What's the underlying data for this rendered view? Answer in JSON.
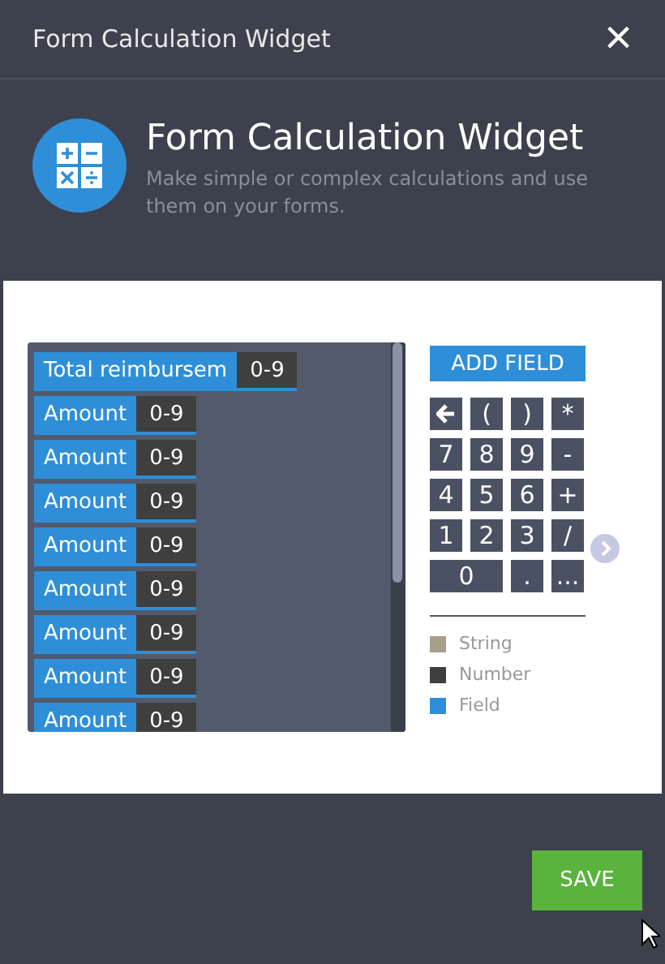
{
  "window": {
    "title": "Form Calculation Widget",
    "close": "×"
  },
  "intro": {
    "title": "Form Calculation Widget",
    "description": "Make simple or complex calculations and use them on your forms."
  },
  "fields": [
    {
      "name": "Total reimbursem",
      "type": "0-9"
    },
    {
      "name": "Amount",
      "type": "0-9"
    },
    {
      "name": "Amount",
      "type": "0-9"
    },
    {
      "name": "Amount",
      "type": "0-9"
    },
    {
      "name": "Amount",
      "type": "0-9"
    },
    {
      "name": "Amount",
      "type": "0-9"
    },
    {
      "name": "Amount",
      "type": "0-9"
    },
    {
      "name": "Amount",
      "type": "0-9"
    },
    {
      "name": "Amount",
      "type": "0-9"
    }
  ],
  "add_field": "ADD FIELD",
  "keys": [
    {
      "kind": "arrow",
      "wide": false
    },
    {
      "label": "(",
      "wide": false
    },
    {
      "label": ")",
      "wide": false
    },
    {
      "label": "*",
      "wide": false
    },
    {
      "label": "7",
      "wide": false
    },
    {
      "label": "8",
      "wide": false
    },
    {
      "label": "9",
      "wide": false
    },
    {
      "label": "-",
      "wide": false
    },
    {
      "label": "4",
      "wide": false
    },
    {
      "label": "5",
      "wide": false
    },
    {
      "label": "6",
      "wide": false
    },
    {
      "label": "+",
      "wide": false
    },
    {
      "label": "1",
      "wide": false
    },
    {
      "label": "2",
      "wide": false
    },
    {
      "label": "3",
      "wide": false
    },
    {
      "label": "/",
      "wide": false
    },
    {
      "label": "0",
      "wide": true
    },
    {
      "label": ".",
      "wide": false
    },
    {
      "label": "...",
      "wide": false
    }
  ],
  "legend": [
    {
      "label": "String",
      "color": "#a89e8c"
    },
    {
      "label": "Number",
      "color": "#3f3f3f"
    },
    {
      "label": "Field",
      "color": "#2e8fd8"
    }
  ],
  "save": "SAVE"
}
